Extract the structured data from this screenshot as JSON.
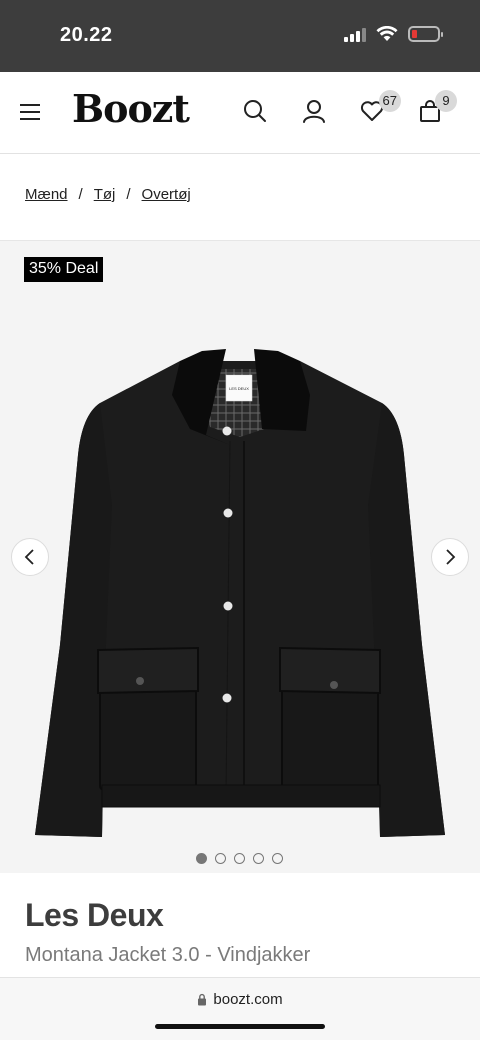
{
  "status": {
    "time": "20.22"
  },
  "header": {
    "logo": "Boozt",
    "favorites_count": "67",
    "cart_count": "9"
  },
  "breadcrumb": {
    "items": [
      "Mænd",
      "Tøj",
      "Overtøj"
    ],
    "separator": "/"
  },
  "gallery": {
    "deal_label": "35% Deal",
    "image_count": 5,
    "active_image": 1,
    "label_text": "LES DEUX"
  },
  "product": {
    "brand": "Les Deux",
    "name": "Montana Jacket 3.0 - Vindjakker"
  },
  "browser": {
    "url": "boozt.com"
  },
  "colors": {
    "status_bar": "#3d3d3d",
    "deal_bg": "#000000",
    "jacket": "#1c1c1c",
    "gallery_bg": "#f4f4f4"
  }
}
